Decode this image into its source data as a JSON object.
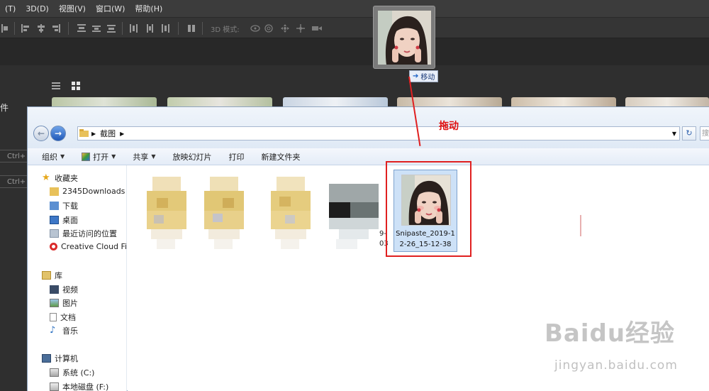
{
  "photoshop": {
    "menu": [
      "(T)",
      "3D(D)",
      "视图(V)",
      "窗口(W)",
      "帮助(H)"
    ],
    "mode_3d_label": "3D 模式:",
    "side_label": "件",
    "shortcuts": [
      "Ctrl+",
      "Ctrl+"
    ]
  },
  "drag": {
    "tooltip_label": "移动",
    "annotation_label": "拖动"
  },
  "explorer": {
    "breadcrumb_folder": "截图",
    "search_placeholder": "搜",
    "toolbar": [
      {
        "label": "组织",
        "dropdown": true,
        "icon": ""
      },
      {
        "label": "打开",
        "dropdown": true,
        "icon": "open-icon"
      },
      {
        "label": "共享",
        "dropdown": true,
        "icon": ""
      },
      {
        "label": "放映幻灯片",
        "dropdown": false,
        "icon": ""
      },
      {
        "label": "打印",
        "dropdown": false,
        "icon": ""
      },
      {
        "label": "新建文件夹",
        "dropdown": false,
        "icon": ""
      }
    ],
    "nav": {
      "favorites_header": "收藏夹",
      "favorites": [
        "2345Downloads",
        "下载",
        "桌面",
        "最近访问的位置",
        "Creative Cloud Fil"
      ],
      "libraries_header": "库",
      "libraries": [
        "视频",
        "图片",
        "文档",
        "音乐"
      ],
      "computer_header": "计算机",
      "drives": [
        "系统 (C:)",
        "本地磁盘 (F:)"
      ]
    },
    "partial_file_label": [
      "9-",
      "03"
    ],
    "selected_file_name": "Snipaste_2019-12-26_15-12-38"
  },
  "watermark": {
    "brand": "Baidu经验",
    "url": "jingyan.baidu.com"
  }
}
